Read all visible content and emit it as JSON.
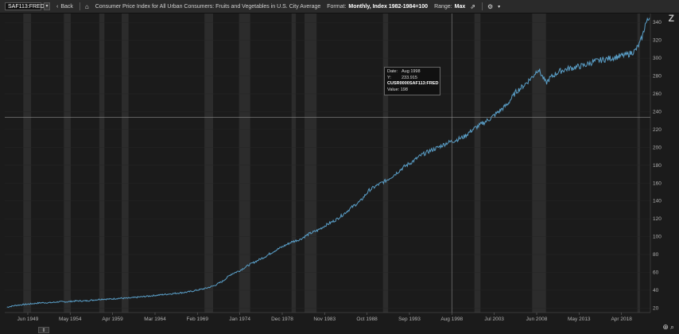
{
  "toolbar": {
    "symbol": "SAF113:FRED",
    "back_label": "Back",
    "title": "Consumer Price Index for All Urban Consumers: Fruits and Vegetables in U.S. City Average",
    "format_label": "Format:",
    "format_value": "Monthly, Index 1982-1984=100",
    "range_label": "Range:",
    "range_value": "Max"
  },
  "tooltip": {
    "date_label": "Date:",
    "date_value": "Aug 1998",
    "y_label": "Y:",
    "y_value": "233.915",
    "series": "CUSR0000SAF113:FRED",
    "value_label": "Value:",
    "value_value": "198"
  },
  "colors": {
    "background": "#1b1b1b",
    "line": "#5a9fc8",
    "recession": "#2c2c2c",
    "grid": "#262626",
    "crosshair": "#8a8a8a"
  },
  "chart_data": {
    "type": "line",
    "title": "Consumer Price Index for All Urban Consumers: Fruits and Vegetables in U.S. City Average",
    "xlabel": "",
    "ylabel": "",
    "xlim": [
      1946.75,
      2021.6
    ],
    "ylim": [
      15,
      350
    ],
    "y_ticks": [
      20,
      40,
      60,
      80,
      100,
      120,
      140,
      160,
      180,
      200,
      220,
      240,
      260,
      280,
      300,
      320,
      340
    ],
    "x_ticks": [
      {
        "label": "Jun 1949",
        "value": 1949.42
      },
      {
        "label": "May 1954",
        "value": 1954.33
      },
      {
        "label": "Apr 1959",
        "value": 1959.25
      },
      {
        "label": "Mar 1964",
        "value": 1964.17
      },
      {
        "label": "Feb 1969",
        "value": 1969.08
      },
      {
        "label": "Jan 1974",
        "value": 1974.0
      },
      {
        "label": "Dec 1978",
        "value": 1978.92
      },
      {
        "label": "Nov 1983",
        "value": 1983.83
      },
      {
        "label": "Oct 1988",
        "value": 1988.75
      },
      {
        "label": "Sep 1993",
        "value": 1993.67
      },
      {
        "label": "Aug 1998",
        "value": 1998.58
      },
      {
        "label": "Jul 2003",
        "value": 2003.5
      },
      {
        "label": "Jun 2008",
        "value": 2008.42
      },
      {
        "label": "May 2013",
        "value": 2013.33
      },
      {
        "label": "Apr 2018",
        "value": 2018.25
      }
    ],
    "recessions": [
      [
        1948.9,
        1949.8
      ],
      [
        1953.6,
        1954.4
      ],
      [
        1957.7,
        1958.3
      ],
      [
        1960.3,
        1961.1
      ],
      [
        1969.9,
        1970.9
      ],
      [
        1973.9,
        1975.2
      ],
      [
        1980.0,
        1980.5
      ],
      [
        1981.5,
        1982.9
      ],
      [
        1990.6,
        1991.2
      ],
      [
        2001.2,
        2001.9
      ],
      [
        2007.9,
        2009.5
      ],
      [
        2020.1,
        2020.4
      ]
    ],
    "crosshair": {
      "x": 1998.58,
      "y": 233.915
    },
    "series": [
      {
        "x": [
          1947.0,
          1948.0,
          1949.0,
          1950.0,
          1951.0,
          1952.0,
          1953.0,
          1954.0,
          1955.0,
          1956.0,
          1957.0,
          1958.0,
          1959.0,
          1960.0,
          1961.0,
          1962.0,
          1963.0,
          1964.0,
          1965.0,
          1966.0,
          1967.0,
          1968.0,
          1969.0,
          1970.0,
          1971.0,
          1972.0,
          1973.0,
          1974.0,
          1975.0,
          1976.0,
          1977.0,
          1978.0,
          1979.0,
          1980.0,
          1981.0,
          1982.0,
          1983.0,
          1984.0,
          1985.0,
          1986.0,
          1987.0,
          1988.0,
          1989.0,
          1990.0,
          1991.0,
          1992.0,
          1993.0,
          1994.0,
          1995.0,
          1996.0,
          1997.0,
          1998.0,
          1999.0,
          2000.0,
          2001.0,
          2002.0,
          2003.0,
          2004.0,
          2005.0,
          2006.0,
          2007.0,
          2008.0,
          2008.6,
          2009.5,
          2010.0,
          2011.0,
          2012.0,
          2013.0,
          2014.0,
          2015.0,
          2016.0,
          2017.0,
          2018.0,
          2019.0,
          2019.8,
          2020.3,
          2020.7,
          2021.0,
          2021.5
        ],
        "values": [
          21,
          23,
          24,
          25,
          26,
          26,
          27,
          27,
          28,
          28,
          29,
          30,
          30,
          31,
          31,
          32,
          33,
          34,
          35,
          36,
          37,
          38,
          40,
          42,
          45,
          50,
          58,
          62,
          68,
          73,
          78,
          84,
          89,
          94,
          97,
          103,
          107,
          113,
          118,
          125,
          133,
          140,
          152,
          158,
          163,
          170,
          178,
          184,
          191,
          196,
          200,
          205,
          208,
          212,
          220,
          226,
          232,
          240,
          248,
          262,
          270,
          280,
          288,
          272,
          278,
          285,
          288,
          290,
          292,
          296,
          298,
          300,
          302,
          304,
          308,
          315,
          325,
          338,
          345
        ]
      }
    ]
  }
}
